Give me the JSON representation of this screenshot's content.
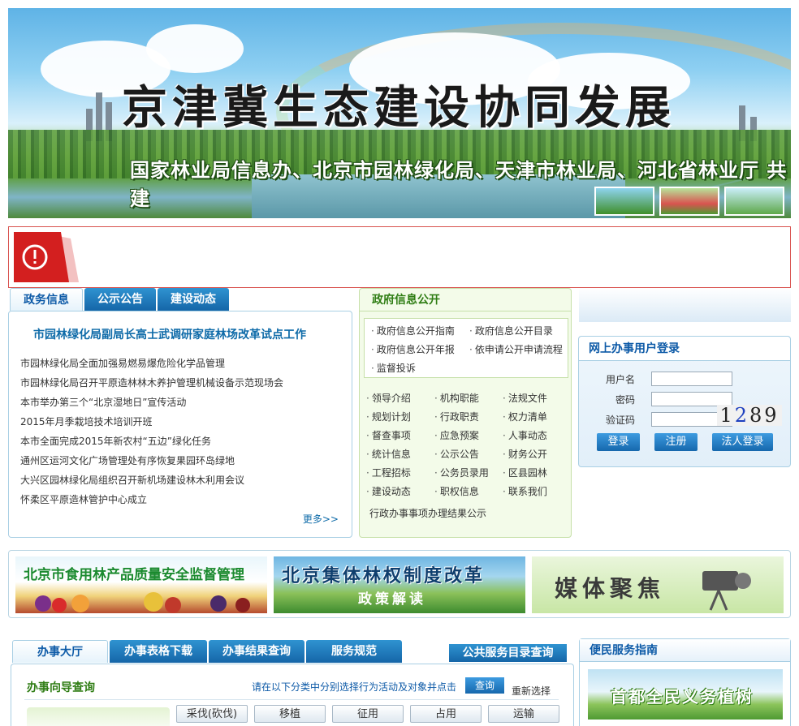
{
  "banner": {
    "title": "京津冀生态建设协同发展",
    "subtitle": "国家林业局信息办、北京市园林绿化局、天津市林业局、河北省林业厅 共建"
  },
  "colors": {
    "accent": "#1566a8",
    "alert": "#d9534f",
    "green": "#2f7d14"
  },
  "news": {
    "tabs": [
      "政务信息",
      "公示公告",
      "建设动态"
    ],
    "headline": "市园林绿化局副局长高士武调研家庭林场改革试点工作",
    "items": [
      "市园林绿化局全面加强易燃易爆危险化学品管理",
      "市园林绿化局召开平原造林林木养护管理机械设备示范现场会",
      "本市举办第三个“北京湿地日”宣传活动",
      "2015年月季栽培技术培训开班",
      "本市全面完成2015年新农村“五边”绿化任务",
      "通州区运河文化广场管理处有序恢复果园环岛绿地",
      "大兴区园林绿化局组织召开新机场建设林木利用会议",
      "怀柔区平原造林管护中心成立"
    ],
    "more": "更多>>"
  },
  "gov": {
    "title": "政府信息公开",
    "box": [
      "政府信息公开指南",
      "政府信息公开目录",
      "政府信息公开年报",
      "依申请公开申请流程",
      "监督投诉"
    ],
    "grid": [
      "领导介绍",
      "机构职能",
      "法规文件",
      "规划计划",
      "行政职责",
      "权力清单",
      "督查事项",
      "应急预案",
      "人事动态",
      "统计信息",
      "公示公告",
      "财务公开",
      "工程招标",
      "公务员录用",
      "区县园林",
      "建设动态",
      "职权信息",
      "联系我们"
    ],
    "last": "行政办事事项办理结果公示"
  },
  "login": {
    "title": "网上办事用户登录",
    "username_label": "用户名",
    "password_label": "密码",
    "captcha_label": "验证码",
    "captcha_a": "1",
    "captcha_b": "2",
    "captcha_c": "89",
    "login_btn": "登录",
    "register_btn": "注册",
    "corp_btn": "法人登录"
  },
  "promos": {
    "p1": "北京市食用林产品质量安全监督管理",
    "p2_main": "北京集体林权制度改革",
    "p2_sub": "政策解读",
    "p3": "媒体聚焦"
  },
  "hall": {
    "tabs": [
      "办事大厅",
      "办事表格下载",
      "办事结果查询",
      "服务规范"
    ],
    "catalog": "公共服务目录查询",
    "title": "办事向导查询",
    "hint": "请在以下分类中分别选择行为活动及对象并点击",
    "query": "查询",
    "reset": "重新选择",
    "categories": [
      "采伐(砍伐)",
      "移植",
      "征用",
      "占用",
      "运输"
    ]
  },
  "guide": {
    "title": "便民服务指南",
    "image_text": "首都全民义务植树"
  }
}
